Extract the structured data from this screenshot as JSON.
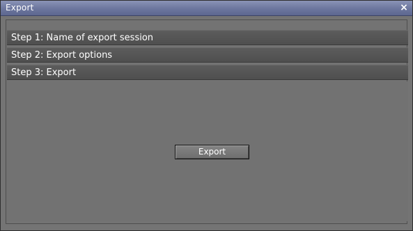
{
  "window": {
    "title": "Export",
    "close_symbol": "×"
  },
  "steps": [
    {
      "label": "Step 1: Name of export session"
    },
    {
      "label": "Step 2: Export options"
    },
    {
      "label": "Step 3: Export"
    }
  ],
  "panel": {
    "export_button_label": "Export"
  },
  "icons": {
    "close": "close-icon"
  },
  "colors": {
    "titlebar": "#6c769e",
    "step_header": "#545454",
    "panel_bg": "#727272",
    "text": "#ffffff"
  }
}
